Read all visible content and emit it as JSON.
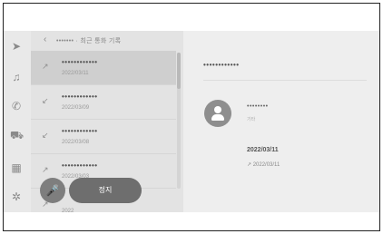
{
  "header": {
    "back_icon": "‹",
    "title": "••••••• · 최근 통화 기록"
  },
  "rail": {
    "icons": [
      {
        "name": "navigation-icon",
        "glyph": "➤"
      },
      {
        "name": "music-icon",
        "glyph": "♫"
      },
      {
        "name": "phone-icon",
        "glyph": "✆"
      },
      {
        "name": "car-icon",
        "glyph": "⛟"
      },
      {
        "name": "apps-icon",
        "glyph": "▦"
      },
      {
        "name": "settings-icon",
        "glyph": "✲"
      }
    ]
  },
  "calls": [
    {
      "direction": "↗",
      "name": "••••••••••••",
      "date": "2022/03/11"
    },
    {
      "direction": "↙",
      "name": "••••••••••••",
      "date": "2022/03/09"
    },
    {
      "direction": "↙",
      "name": "••••••••••••",
      "date": "2022/03/08"
    },
    {
      "direction": "↗",
      "name": "••••••••••••",
      "date": "2022/03/03"
    },
    {
      "direction": "↗",
      "name": "",
      "date": "2022"
    }
  ],
  "buttons": {
    "mic_icon": "🎤",
    "action_label": "정지"
  },
  "detail": {
    "name": "••••••••••••",
    "contact_name": "••••••••",
    "contact_sub": "기타",
    "call_date": "2022/03/11",
    "call_direction": "↗",
    "call_time": "2022/03/11"
  },
  "colors": {
    "screen_bg": "#eeeeee",
    "selected_row": "#cfcfcf",
    "button_bg": "#6e6e6e"
  }
}
